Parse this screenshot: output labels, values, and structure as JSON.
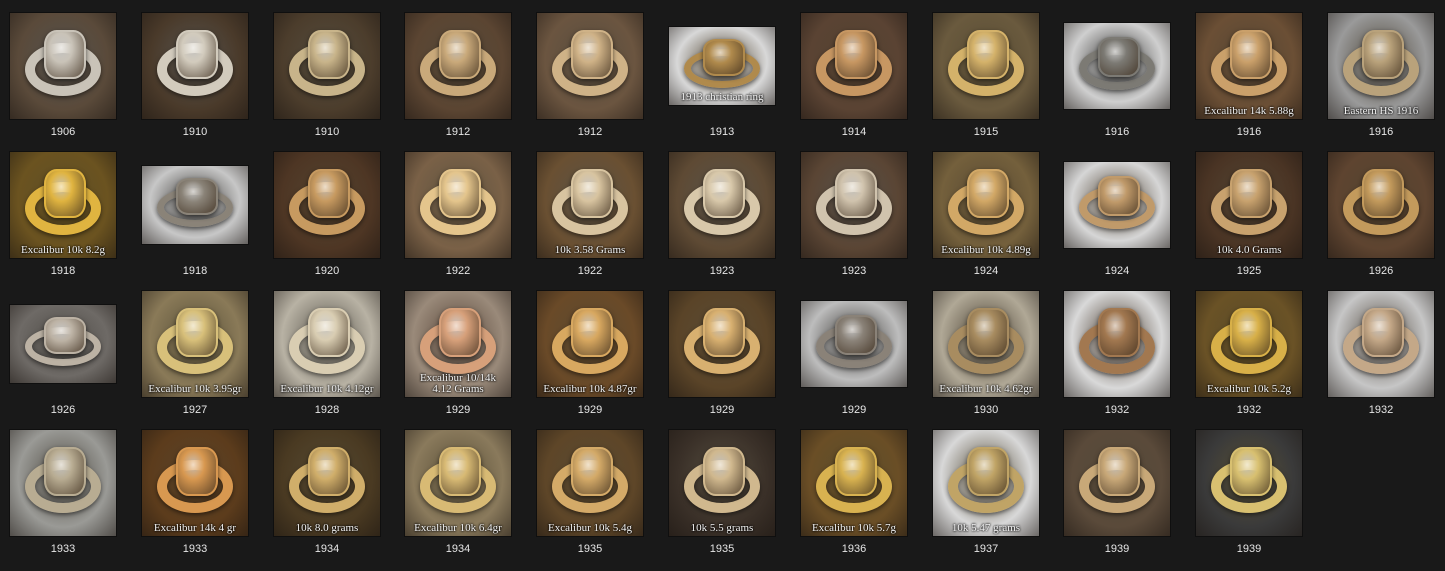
{
  "gallery": {
    "items": [
      {
        "year": "1906",
        "caption": "",
        "bg": "#5a4a3a",
        "metal": "#c9c3b8",
        "w": 106,
        "h": 106
      },
      {
        "year": "1910",
        "caption": "",
        "bg": "#4a3a2a",
        "metal": "#d2cbbd",
        "w": 106,
        "h": 106
      },
      {
        "year": "1910",
        "caption": "",
        "bg": "#4c3d2c",
        "metal": "#c8b48a",
        "w": 106,
        "h": 106
      },
      {
        "year": "1912",
        "caption": "",
        "bg": "#5b4532",
        "metal": "#c9a97a",
        "w": 106,
        "h": 106
      },
      {
        "year": "1912",
        "caption": "",
        "bg": "#6b5540",
        "metal": "#cfb287",
        "w": 106,
        "h": 106
      },
      {
        "year": "1913",
        "caption": "1913 christian ring",
        "bg": "#d8d8d8",
        "metal": "#b08a4c",
        "w": 106,
        "h": 78
      },
      {
        "year": "1914",
        "caption": "",
        "bg": "#5a4333",
        "metal": "#c79762",
        "w": 106,
        "h": 106
      },
      {
        "year": "1915",
        "caption": "",
        "bg": "#6a5a3e",
        "metal": "#d4b26a",
        "w": 106,
        "h": 106
      },
      {
        "year": "1916",
        "caption": "",
        "bg": "#cfcfcf",
        "metal": "#7c7a74",
        "w": 106,
        "h": 86
      },
      {
        "year": "1916",
        "caption": "Excalibur 14k 5.88g",
        "bg": "#6b4f35",
        "metal": "#caa06a",
        "w": 106,
        "h": 106
      },
      {
        "year": "1916",
        "caption": "Eastern HS 1916",
        "bg": "#9a9a9a",
        "metal": "#b9a27b",
        "w": 106,
        "h": 106
      },
      {
        "year": "1918",
        "caption": "Excalibur 10k 8.2g",
        "bg": "#6b5320",
        "metal": "#e0b440",
        "w": 106,
        "h": 106
      },
      {
        "year": "1918",
        "caption": "",
        "bg": "#c7c7c7",
        "metal": "#8a8378",
        "w": 106,
        "h": 78
      },
      {
        "year": "1920",
        "caption": "",
        "bg": "#4e3624",
        "metal": "#c79a60",
        "w": 106,
        "h": 106
      },
      {
        "year": "1922",
        "caption": "",
        "bg": "#7a6147",
        "metal": "#e4c58c",
        "w": 106,
        "h": 106
      },
      {
        "year": "1922",
        "caption": "10k 3.58 Grams",
        "bg": "#6a5032",
        "metal": "#d8c4a0",
        "w": 106,
        "h": 106
      },
      {
        "year": "1923",
        "caption": "",
        "bg": "#5e4a34",
        "metal": "#d8c8aa",
        "w": 106,
        "h": 106
      },
      {
        "year": "1923",
        "caption": "",
        "bg": "#5a4534",
        "metal": "#d0c3ad",
        "w": 106,
        "h": 106
      },
      {
        "year": "1924",
        "caption": "Excalibur 10k 4.89g",
        "bg": "#74603c",
        "metal": "#d2a866",
        "w": 106,
        "h": 106
      },
      {
        "year": "1924",
        "caption": "",
        "bg": "#d6d6d6",
        "metal": "#c09a6a",
        "w": 106,
        "h": 86
      },
      {
        "year": "1925",
        "caption": "10k 4.0 Grams",
        "bg": "#4a3424",
        "metal": "#c8a26e",
        "w": 106,
        "h": 106
      },
      {
        "year": "1926",
        "caption": "",
        "bg": "#5e4430",
        "metal": "#c39a5c",
        "w": 106,
        "h": 106
      },
      {
        "year": "1926",
        "caption": "",
        "bg": "#6e6a66",
        "metal": "#bcb2a4",
        "w": 106,
        "h": 78
      },
      {
        "year": "1927",
        "caption": "Excalibur 10k 3.95gr",
        "bg": "#8a7a58",
        "metal": "#d8c07a",
        "w": 106,
        "h": 106
      },
      {
        "year": "1928",
        "caption": "Excalibur 10k 4.12gr",
        "bg": "#b8b2a4",
        "metal": "#d9cdb2",
        "w": 106,
        "h": 106
      },
      {
        "year": "1929",
        "caption": "Excalibur 10/14k\n4.12 Grams",
        "bg": "#9a8a7a",
        "metal": "#d7a07a",
        "w": 106,
        "h": 106
      },
      {
        "year": "1929",
        "caption": "Excalibur 10k 4.87gr",
        "bg": "#6a4a28",
        "metal": "#d8a860",
        "w": 106,
        "h": 106
      },
      {
        "year": "1929",
        "caption": "",
        "bg": "#5a4428",
        "metal": "#d8b070",
        "w": 106,
        "h": 106
      },
      {
        "year": "1929",
        "caption": "",
        "bg": "#bdbdbd",
        "metal": "#8a8278",
        "w": 106,
        "h": 86
      },
      {
        "year": "1930",
        "caption": "Excalibur 10k 4.62gr",
        "bg": "#b0a896",
        "metal": "#a88c60",
        "w": 106,
        "h": 106
      },
      {
        "year": "1932",
        "caption": "",
        "bg": "#d9d9d9",
        "metal": "#a27850",
        "w": 106,
        "h": 106
      },
      {
        "year": "1932",
        "caption": "Excalibur 10k 5.2g",
        "bg": "#6a5226",
        "metal": "#d8b048",
        "w": 106,
        "h": 106
      },
      {
        "year": "1932",
        "caption": "",
        "bg": "#c6c6c6",
        "metal": "#c4a888",
        "w": 106,
        "h": 106
      },
      {
        "year": "1933",
        "caption": "",
        "bg": "#9a9a96",
        "metal": "#b8ac92",
        "w": 106,
        "h": 106
      },
      {
        "year": "1933",
        "caption": "Excalibur 14k 4 gr",
        "bg": "#5c3c1c",
        "metal": "#d89850",
        "w": 106,
        "h": 106
      },
      {
        "year": "1934",
        "caption": "10k 8.0 grams",
        "bg": "#4a3a22",
        "metal": "#d0ae6a",
        "w": 106,
        "h": 106
      },
      {
        "year": "1934",
        "caption": "Excalibur 10k 6.4gr",
        "bg": "#8a7a5c",
        "metal": "#d8ba74",
        "w": 106,
        "h": 106
      },
      {
        "year": "1935",
        "caption": "Excalibur 10k 5.4g",
        "bg": "#5e4628",
        "metal": "#d4aa68",
        "w": 106,
        "h": 106
      },
      {
        "year": "1935",
        "caption": "10k 5.5 grams",
        "bg": "#3a3028",
        "metal": "#d0b88e",
        "w": 106,
        "h": 106
      },
      {
        "year": "1936",
        "caption": "Excalibur 10k 5.7g",
        "bg": "#6a4e26",
        "metal": "#d8b250",
        "w": 106,
        "h": 106
      },
      {
        "year": "1937",
        "caption": "10k 5.47 grams",
        "bg": "#d8d8d8",
        "metal": "#c0a466",
        "w": 106,
        "h": 106
      },
      {
        "year": "1939",
        "caption": "",
        "bg": "#5a4a3a",
        "metal": "#c8a878",
        "w": 106,
        "h": 106
      },
      {
        "year": "1939",
        "caption": "",
        "bg": "#3a3a3a",
        "metal": "#d8c070",
        "w": 106,
        "h": 106
      }
    ]
  }
}
